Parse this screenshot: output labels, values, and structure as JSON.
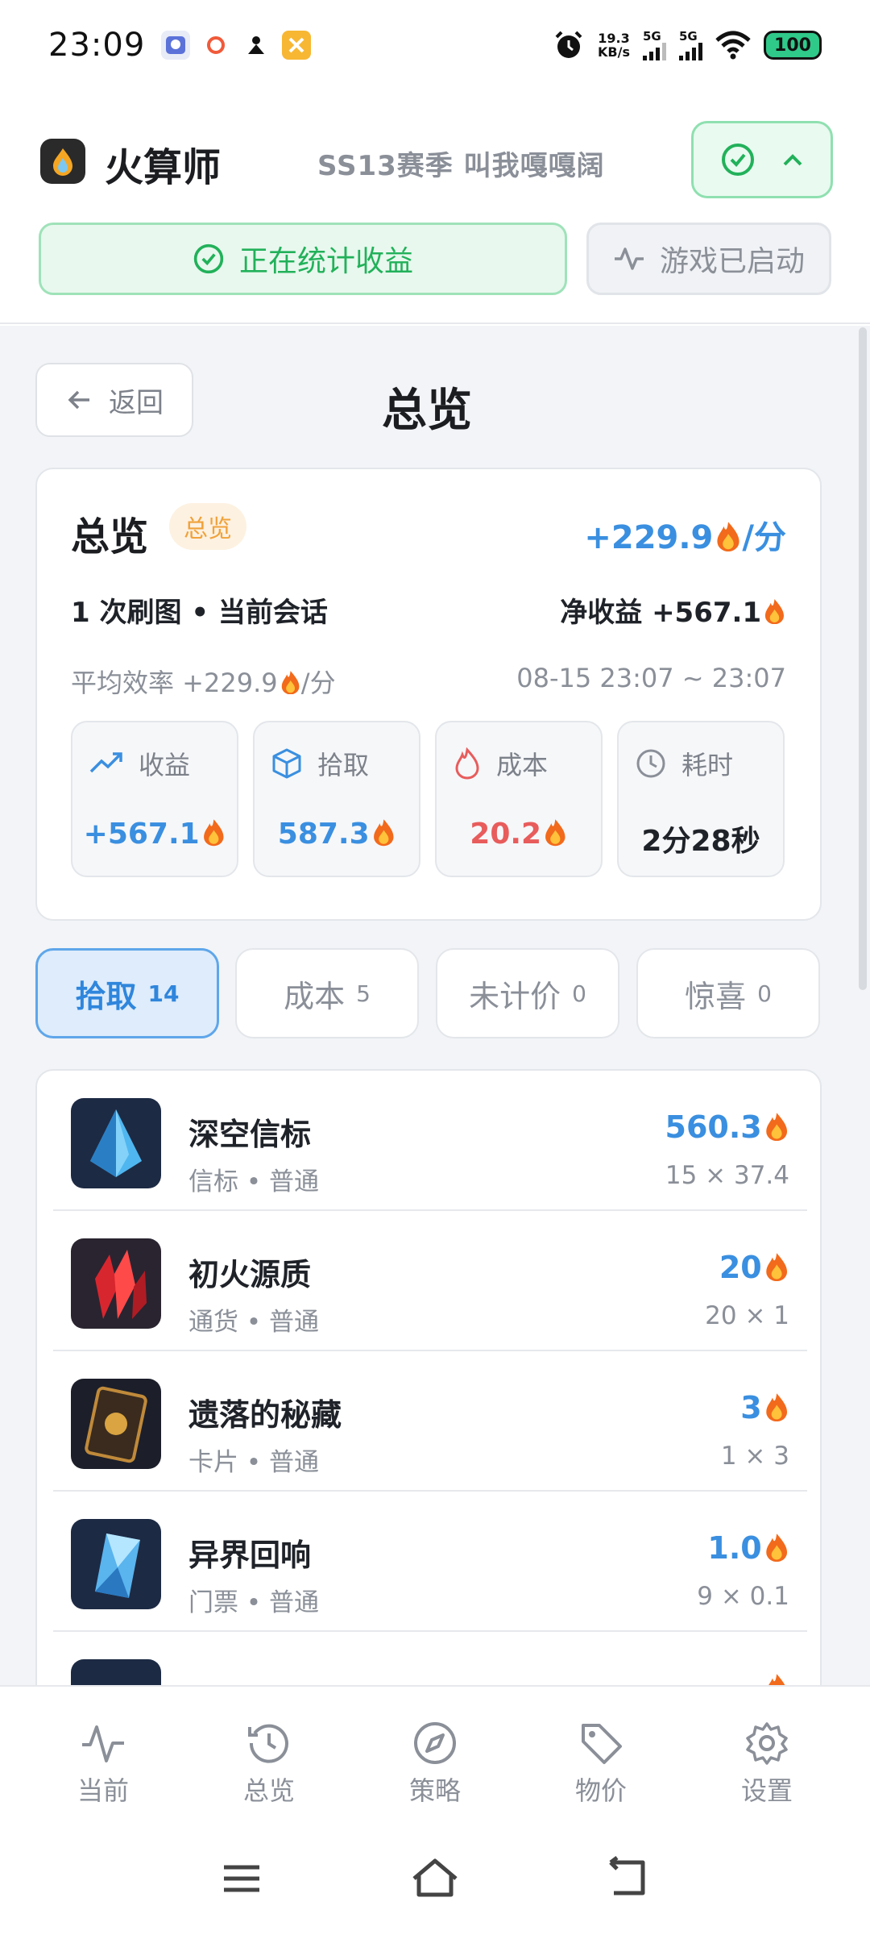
{
  "status_bar": {
    "time": "23:09",
    "net_speed_value": "19.3",
    "net_speed_unit": "KB/s",
    "sim1": "5G",
    "sim2": "5G",
    "battery": "100"
  },
  "header": {
    "app_name": "火算师",
    "season": "SS13赛季  叫我嘎嘎阔",
    "status_active": "正在统计收益",
    "status_game": "游戏已启动"
  },
  "page": {
    "back_label": "返回",
    "title": "总览"
  },
  "summary": {
    "title": "总览",
    "badge": "总览",
    "rate": "+229.9",
    "rate_unit": "/分",
    "runs": "1 次刷图 • 当前会话",
    "net_label": "净收益 +567.1",
    "avg": "平均效率 +229.9",
    "avg_unit": "/分",
    "range": "08-15 23:07 ~ 23:07",
    "stats": [
      {
        "label": "收益",
        "value": "+567.1",
        "icon": "trending-up-icon",
        "color": "#3a8fe0"
      },
      {
        "label": "拾取",
        "value": "587.3",
        "icon": "box-icon",
        "color": "#3a8fe0"
      },
      {
        "label": "成本",
        "value": "20.2",
        "icon": "flame-icon",
        "color": "#e85c5c"
      },
      {
        "label": "耗时",
        "value": "2分28秒",
        "icon": "clock-icon",
        "color": "#1f2329"
      }
    ]
  },
  "tabs": [
    {
      "label": "拾取",
      "count": "14"
    },
    {
      "label": "成本",
      "count": "5"
    },
    {
      "label": "未计价",
      "count": "0"
    },
    {
      "label": "惊喜",
      "count": "0"
    }
  ],
  "items": [
    {
      "name": "深空信标",
      "sub": "信标 • 普通",
      "value": "560.3",
      "qty": "15 × 37.4"
    },
    {
      "name": "初火源质",
      "sub": "通货 • 普通",
      "value": "20",
      "qty": "20 × 1"
    },
    {
      "name": "遗落的秘藏",
      "sub": "卡片 • 普通",
      "value": "3",
      "qty": "1 × 3"
    },
    {
      "name": "异界回响",
      "sub": "门票 • 普通",
      "value": "1.0",
      "qty": "9 × 0.1"
    }
  ],
  "nav": [
    {
      "label": "当前",
      "icon": "activity-icon"
    },
    {
      "label": "总览",
      "icon": "history-icon"
    },
    {
      "label": "策略",
      "icon": "compass-icon"
    },
    {
      "label": "物价",
      "icon": "tag-icon"
    },
    {
      "label": "设置",
      "icon": "gear-icon"
    }
  ],
  "colors": {
    "accent_blue": "#3a8fe0",
    "success_green": "#22b15a",
    "cost_red": "#e85c5c",
    "badge_orange": "#f0a23a",
    "fire": "#f26a1b"
  }
}
